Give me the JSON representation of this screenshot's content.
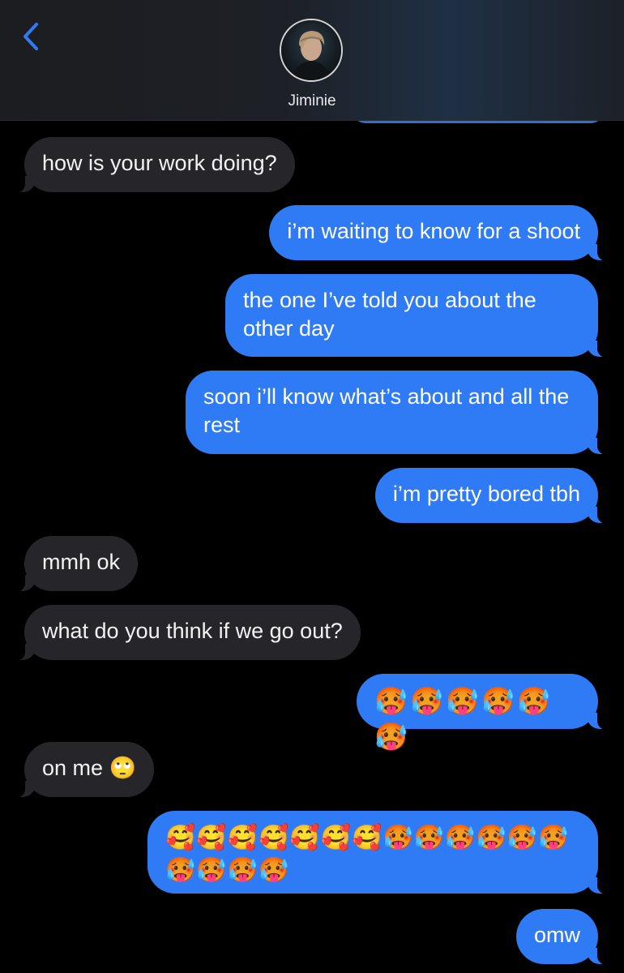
{
  "header": {
    "contact_name": "Jiminie"
  },
  "colors": {
    "outgoing_bubble": "#2f7bf6",
    "incoming_bubble": "#26262a",
    "accent": "#2f7bf6",
    "background": "#000000"
  },
  "icons": {
    "back": "chevron-left-icon"
  },
  "messages": [
    {
      "direction": "incoming",
      "text": "how is your work doing?"
    },
    {
      "direction": "outgoing",
      "text": "i’m waiting to know for a shoot"
    },
    {
      "direction": "outgoing",
      "text": "the one I’ve told you about the other day"
    },
    {
      "direction": "outgoing",
      "text": "soon i’ll know what’s about and all the rest"
    },
    {
      "direction": "outgoing",
      "text": "i’m pretty bored tbh"
    },
    {
      "direction": "incoming",
      "text": "mmh ok"
    },
    {
      "direction": "incoming",
      "text": "what do you think if we go out?"
    },
    {
      "direction": "outgoing",
      "text": "🥵🥵🥵🥵🥵🥵"
    },
    {
      "direction": "incoming",
      "text": "on me 🙄"
    },
    {
      "direction": "outgoing",
      "text": "🥰🥰🥰🥰🥰🥰🥰🥵🥵🥵🥵🥵🥵🥵🥵🥵🥵"
    },
    {
      "direction": "outgoing",
      "text": "omw"
    }
  ]
}
